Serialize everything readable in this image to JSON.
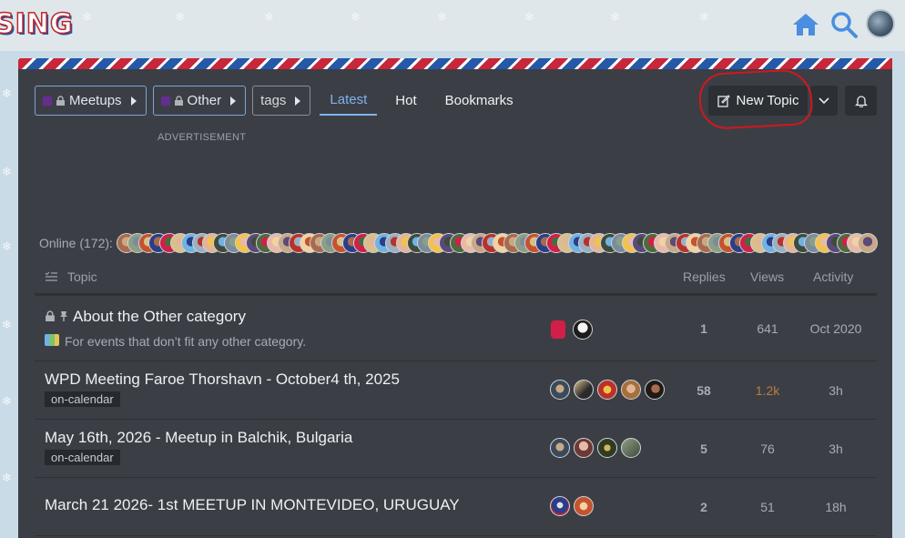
{
  "header": {
    "logo_text": "SING",
    "logo_box_letter": "G"
  },
  "nav": {
    "breadcrumbs": [
      {
        "label": "Meetups",
        "color": "#652d90"
      },
      {
        "label": "Other",
        "color": "#652d90"
      },
      {
        "label": "tags"
      }
    ],
    "tabs": [
      {
        "label": "Latest",
        "active": true
      },
      {
        "label": "Hot"
      },
      {
        "label": "Bookmarks"
      }
    ],
    "new_topic_label": "New Topic"
  },
  "ad_label": "ADVERTISEMENT",
  "online_label": "Online (172):",
  "table": {
    "col_topic": "Topic",
    "col_replies": "Replies",
    "col_views": "Views",
    "col_activity": "Activity"
  },
  "topics": [
    {
      "title": "About the Other category",
      "excerpt": "For events that don’t fit any other category.",
      "pinned": true,
      "locked": true,
      "replies": "1",
      "views": "641",
      "activity": "Oct 2020"
    },
    {
      "title": "WPD Meeting Faroe Thorshavn - October4 th, 2025",
      "tag": "on-calendar",
      "replies": "58",
      "views": "1.2k",
      "views_hot": true,
      "activity": "3h"
    },
    {
      "title": "May 16th, 2026 - Meetup in Balchik, Bulgaria",
      "tag": "on-calendar",
      "replies": "5",
      "views": "76",
      "activity": "3h"
    },
    {
      "title": "March 21 2026- 1st MEETUP IN MONTEVIDEO, URUGUAY",
      "replies": "2",
      "views": "51",
      "activity": "18h"
    }
  ],
  "colors": {
    "accent": "#7fb2f0",
    "panel_bg": "#3b3f45",
    "hot_views": "#c07a3c",
    "annotation": "#d0181f"
  }
}
